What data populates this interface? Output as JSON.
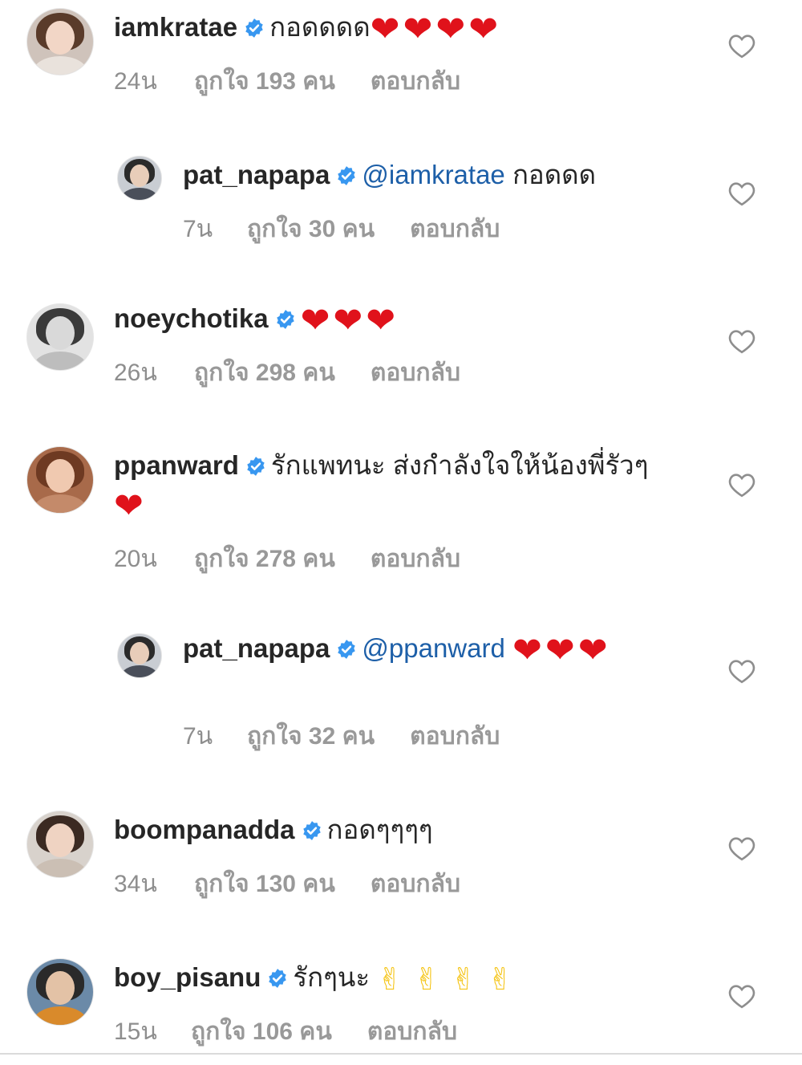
{
  "comments": [
    {
      "username": "iamkratae",
      "mention": "",
      "text": "กอดดดด",
      "emoji": "❤❤❤❤",
      "time": "24น",
      "likes": "ถูกใจ 193 คน",
      "reply_label": "ตอบกลับ",
      "avatar_colors": {
        "bg": "#cfc3bb",
        "hair": "#5a3b2a",
        "face": "#f2d6c6",
        "body": "#e9e2dc"
      }
    },
    {
      "username": "pat_napapa",
      "mention": "@iamkratae",
      "text": "กอดดด",
      "emoji": "",
      "time": "7น",
      "likes": "ถูกใจ 30 คน",
      "reply_label": "ตอบกลับ",
      "avatar_colors": {
        "bg": "#c9cdd3",
        "hair": "#2b2b2b",
        "face": "#e8cdb9",
        "body": "#4a4f5a"
      }
    },
    {
      "username": "noeychotika",
      "mention": "",
      "text": "",
      "emoji": "❤❤❤",
      "time": "26น",
      "likes": "ถูกใจ 298 คน",
      "reply_label": "ตอบกลับ",
      "avatar_colors": {
        "bg": "#e2e2e2",
        "hair": "#3a3a3a",
        "face": "#d9d9d9",
        "body": "#bdbdbd"
      }
    },
    {
      "username": "ppanward",
      "mention": "",
      "text": "รักแพทนะ ส่งกำลังใจให้น้องพี่รัวๆ",
      "emoji": "❤",
      "time": "20น",
      "likes": "ถูกใจ 278 คน",
      "reply_label": "ตอบกลับ",
      "avatar_colors": {
        "bg": "#a86a4a",
        "hair": "#6e3a22",
        "face": "#f0c9b0",
        "body": "#c48a6a"
      }
    },
    {
      "username": "pat_napapa",
      "mention": "@ppanward",
      "text": "",
      "emoji": "❤❤❤",
      "time": "7น",
      "likes": "ถูกใจ 32 คน",
      "reply_label": "ตอบกลับ",
      "avatar_colors": {
        "bg": "#c9cdd3",
        "hair": "#2b2b2b",
        "face": "#e8cdb9",
        "body": "#4a4f5a"
      }
    },
    {
      "username": "boompanadda",
      "mention": "",
      "text": "กอดๆๆๆๆ",
      "emoji": "",
      "time": "34น",
      "likes": "ถูกใจ 130 คน",
      "reply_label": "ตอบกลับ",
      "avatar_colors": {
        "bg": "#d8d2cc",
        "hair": "#3b2a22",
        "face": "#efd3c2",
        "body": "#cbbfb4"
      }
    },
    {
      "username": "boy_pisanu",
      "mention": "",
      "text": "รักๆนะ",
      "emoji": "✌✌✌✌",
      "time": "15น",
      "likes": "ถูกใจ 106 คน",
      "reply_label": "ตอบกลับ",
      "avatar_colors": {
        "bg": "#6b8aa8",
        "hair": "#2a2a2a",
        "face": "#e3c2a6",
        "body": "#d98a2b"
      }
    }
  ],
  "colors": {
    "verified_badge": "#3897f0",
    "mention": "#1d5fa8",
    "meta_text": "#8e8e8e",
    "heart_emoji": "#e0121b"
  },
  "icons": {
    "verified": "verified-badge-icon",
    "like": "heart-outline-icon"
  }
}
